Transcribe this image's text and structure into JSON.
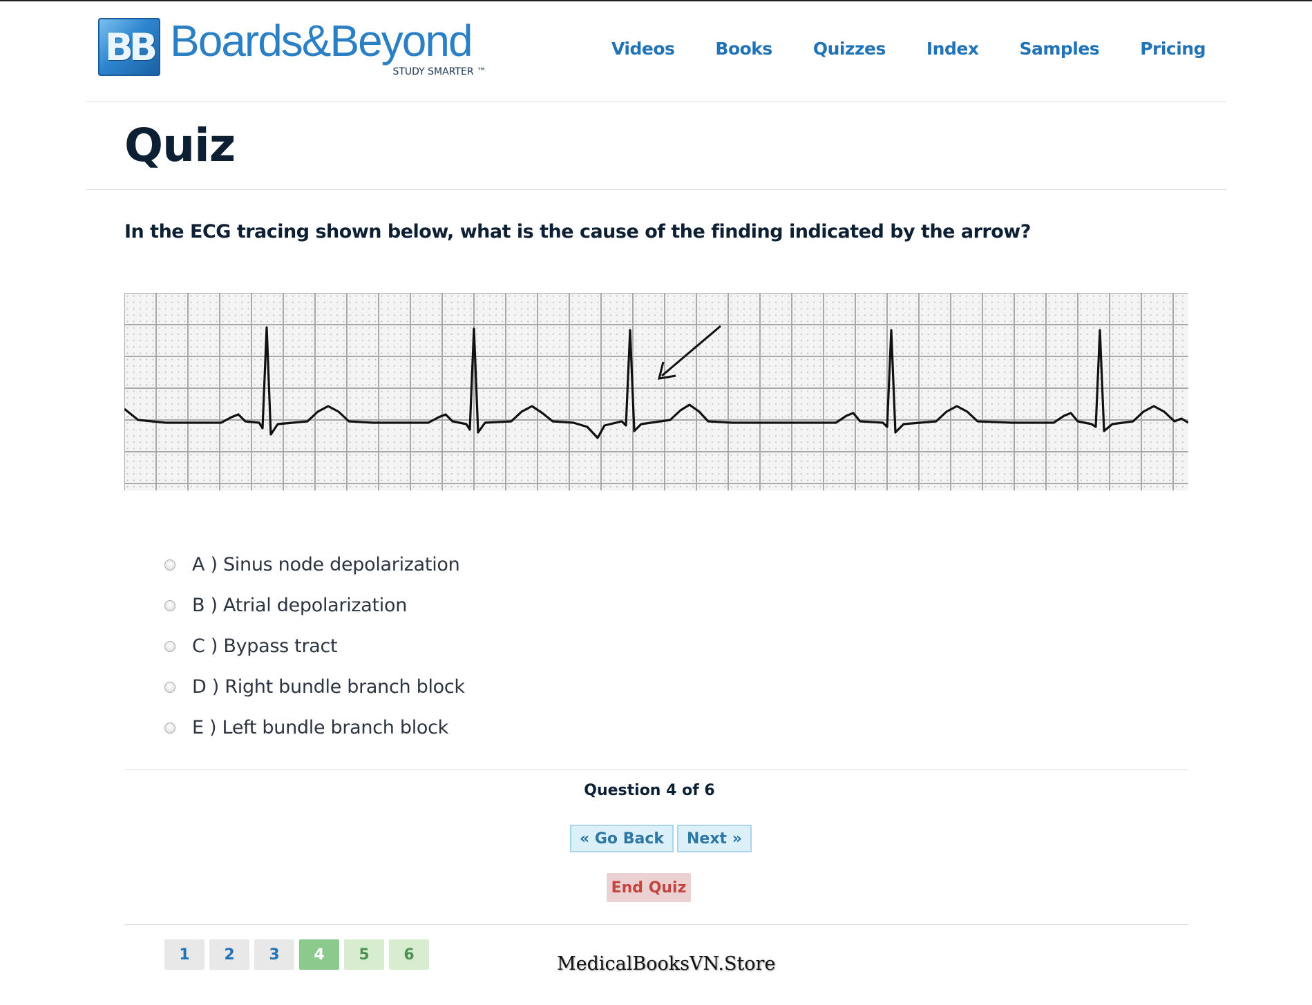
{
  "header": {
    "logo_mark": "BB",
    "logo_word": "Boards&Beyond",
    "logo_tagline": "STUDY SMARTER ™",
    "nav": [
      "Videos",
      "Books",
      "Quizzes",
      "Index",
      "Samples",
      "Pricing"
    ]
  },
  "page_title": "Quiz",
  "question": {
    "text": "In the ECG tracing shown below, what is the cause of the finding indicated by the arrow?",
    "options": [
      {
        "letter": "A",
        "text": "A ) Sinus node depolarization"
      },
      {
        "letter": "B",
        "text": "B ) Atrial depolarization"
      },
      {
        "letter": "C",
        "text": "C ) Bypass tract"
      },
      {
        "letter": "D",
        "text": "D ) Right bundle branch block"
      },
      {
        "letter": "E",
        "text": "E ) Left bundle branch block"
      }
    ]
  },
  "progress": {
    "label": "Question 4 of 6",
    "current": 4,
    "total": 6
  },
  "controls": {
    "go_back": "« Go Back",
    "next": "Next »",
    "end_quiz": "End Quiz"
  },
  "question_numbers": [
    {
      "label": "1",
      "state": "done"
    },
    {
      "label": "2",
      "state": "done"
    },
    {
      "label": "3",
      "state": "done"
    },
    {
      "label": "4",
      "state": "current"
    },
    {
      "label": "5",
      "state": "upcoming"
    },
    {
      "label": "6",
      "state": "upcoming"
    }
  ],
  "watermark": "MedicalBooksVN.Store",
  "colors": {
    "nav_link": "#2272b6",
    "title": "#0d1f33",
    "button_bg": "#dcf0fa",
    "end_quiz_bg": "#ecd1d2",
    "end_quiz_text": "#c2453f",
    "current_question": "#8cc98d"
  }
}
